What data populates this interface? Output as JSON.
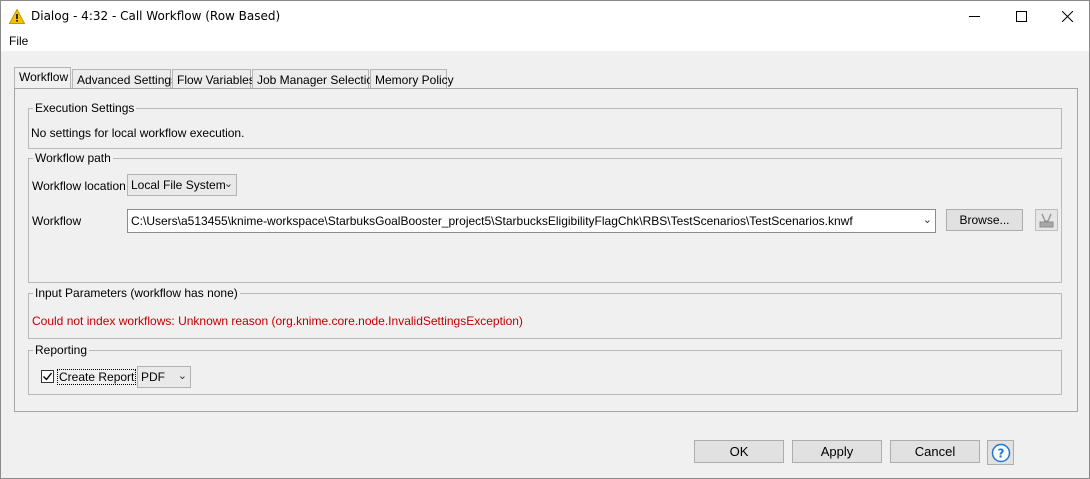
{
  "window": {
    "title": "Dialog - 4:32 - Call Workflow (Row Based)",
    "controls": {
      "minimize": "—",
      "maximize": "☐",
      "close": "✕"
    }
  },
  "menu": {
    "file": "File"
  },
  "tabs": [
    {
      "label": "Workflow",
      "active": true
    },
    {
      "label": "Advanced Settings"
    },
    {
      "label": "Flow Variables"
    },
    {
      "label": "Job Manager Selection"
    },
    {
      "label": "Memory Policy"
    }
  ],
  "execution_settings": {
    "title": "Execution Settings",
    "text": "No settings for local workflow execution."
  },
  "workflow_path": {
    "title": "Workflow path",
    "location_label": "Workflow location",
    "location_value": "Local File System",
    "workflow_label": "Workflow",
    "workflow_value": "C:\\Users\\a513455\\knime-workspace\\StarbuksGoalBooster_project5\\StarbucksEligibilityFlagChk\\RBS\\TestScenarios\\TestScenarios.knwf",
    "browse_label": "Browse..."
  },
  "input_parameters": {
    "title": "Input Parameters (workflow has none)",
    "error": "Could not index workflows: Unknown reason (org.knime.core.node.InvalidSettingsException)"
  },
  "reporting": {
    "title": "Reporting",
    "create_report_label": "Create Report",
    "create_report_checked": true,
    "format_value": "PDF"
  },
  "buttons": {
    "ok": "OK",
    "apply": "Apply",
    "cancel": "Cancel"
  },
  "colors": {
    "error": "#c00000",
    "warning_icon": "#f3c200",
    "help_accent": "#1f77d0"
  },
  "icons": {
    "title_icon": "warning-triangle-icon",
    "help_icon": "question-mark-icon",
    "disabled_tool_icon": "disabled-tool-icon"
  }
}
